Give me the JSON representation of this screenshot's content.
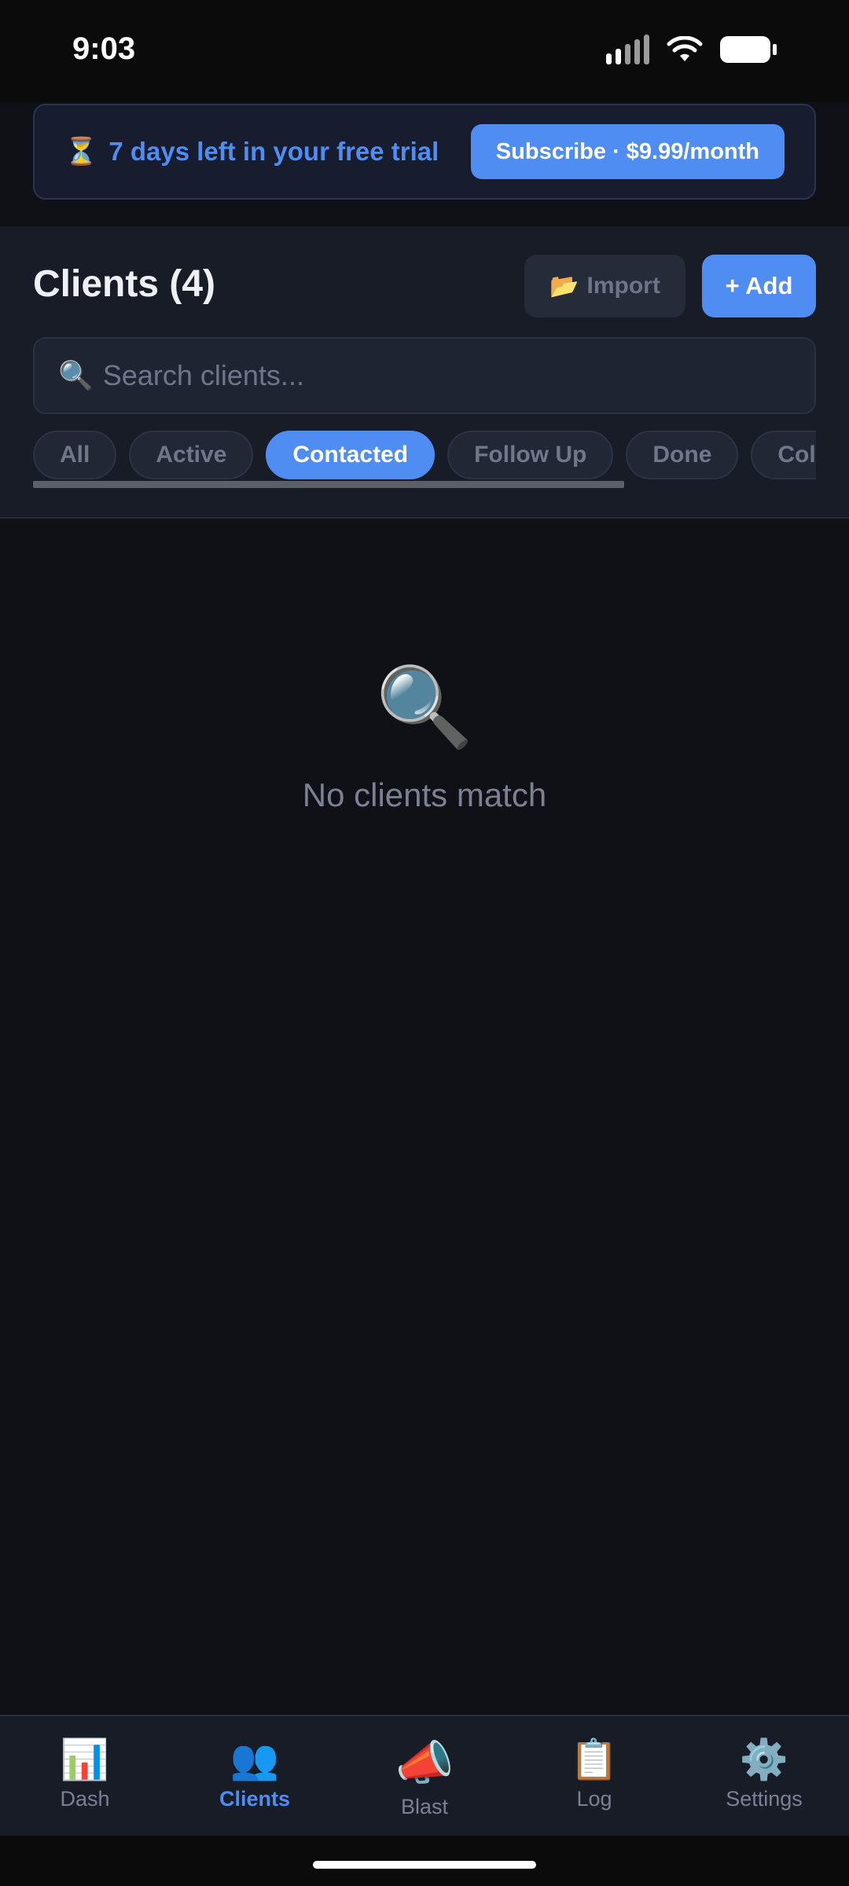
{
  "status_bar": {
    "time": "9:03"
  },
  "trial_banner": {
    "icon": "⏳",
    "text": "7 days left in your free trial",
    "subscribe_label": "Subscribe · $9.99/month"
  },
  "clients": {
    "title": "Clients (4)",
    "import_icon": "📂",
    "import_label": "Import",
    "add_label": "+ Add",
    "search_icon": "🔍",
    "search_placeholder": "Search clients...",
    "filters": [
      {
        "label": "All",
        "selected": false
      },
      {
        "label": "Active",
        "selected": false
      },
      {
        "label": "Contacted",
        "selected": true
      },
      {
        "label": "Follow Up",
        "selected": false
      },
      {
        "label": "Done",
        "selected": false
      },
      {
        "label": "Cold",
        "selected": false
      }
    ]
  },
  "empty_state": {
    "icon": "🔍",
    "text": "No clients match"
  },
  "bottom_nav": {
    "items": [
      {
        "icon": "📊",
        "label": "Dash"
      },
      {
        "icon": "👥",
        "label": "Clients"
      },
      {
        "icon": "📣",
        "label": "Blast"
      },
      {
        "icon": "📋",
        "label": "Log"
      },
      {
        "icon": "⚙️",
        "label": "Settings"
      }
    ],
    "active": "Clients"
  },
  "colors": {
    "accent": "#4f8df3",
    "background": "#101116",
    "panel": "#181c27"
  }
}
